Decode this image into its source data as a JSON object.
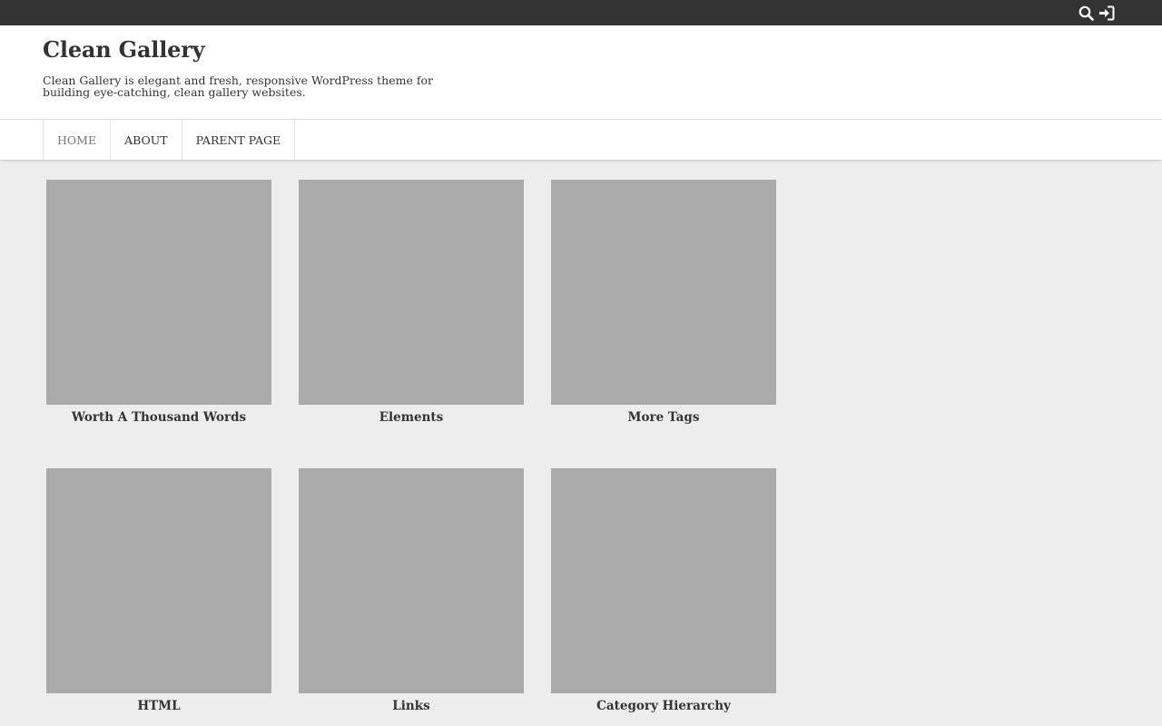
{
  "topbar": {
    "icons": [
      "search-icon",
      "sign-in-icon"
    ],
    "background": "#333333"
  },
  "header": {
    "title": "Clean Gallery",
    "description": "Clean Gallery is elegant and fresh, responsive WordPress theme for building eye-catching, clean gallery websites."
  },
  "nav": {
    "items": [
      {
        "label": "HOME",
        "active": true
      },
      {
        "label": "ABOUT",
        "active": false
      },
      {
        "label": "PARENT PAGE",
        "active": false
      }
    ]
  },
  "posts": [
    {
      "title": "Worth A Thousand Words"
    },
    {
      "title": "Elements"
    },
    {
      "title": "More Tags"
    },
    {
      "title": "HTML"
    },
    {
      "title": "Links"
    },
    {
      "title": "Category Hierarchy"
    }
  ],
  "colors": {
    "page_bg": "#ededed",
    "thumb_placeholder": "#aaaaaa",
    "text": "#333333"
  }
}
